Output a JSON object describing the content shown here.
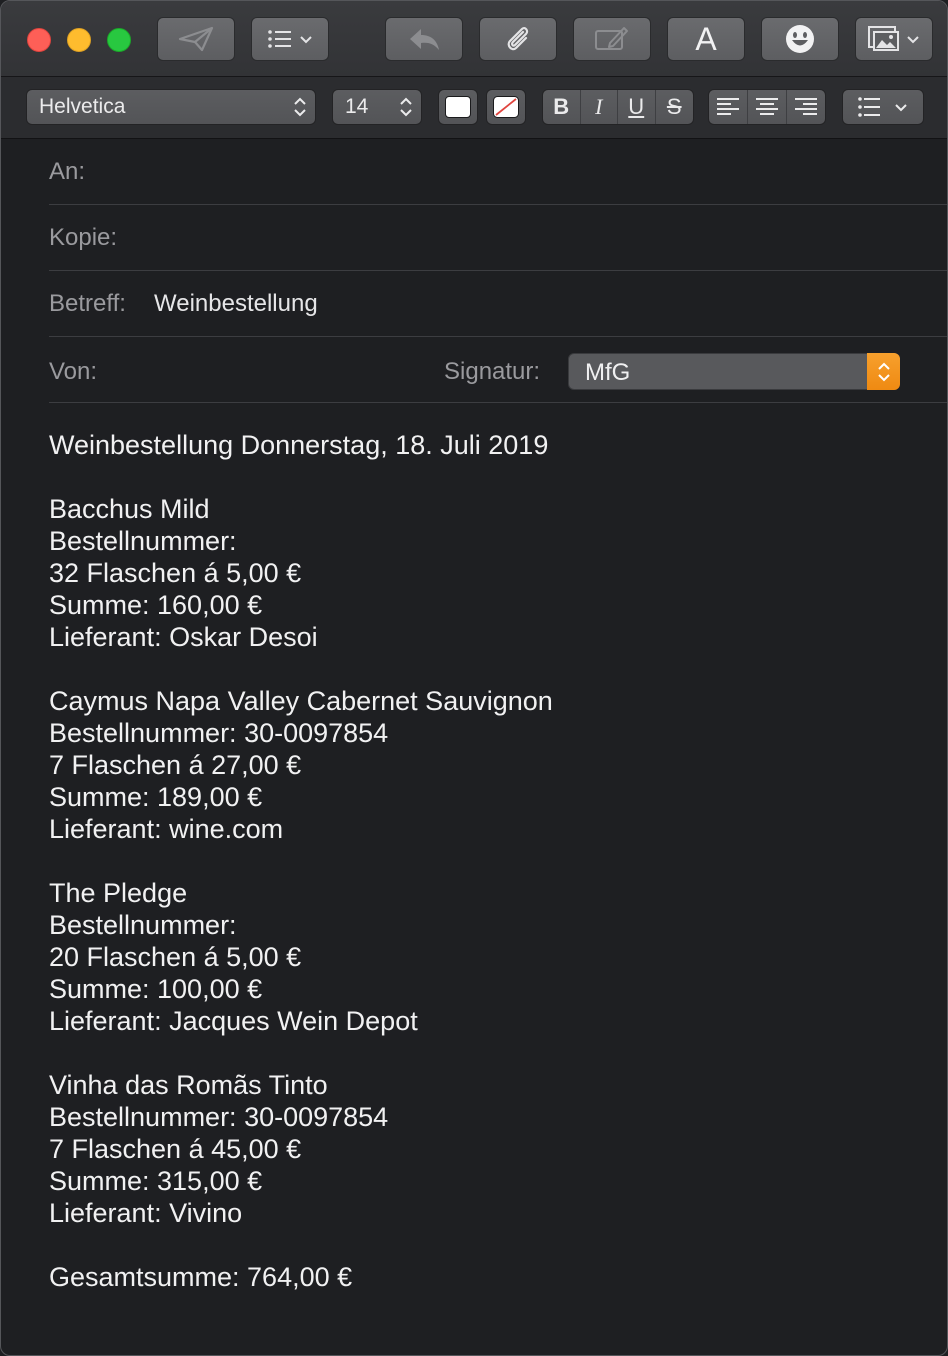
{
  "toolbar": {
    "buttons": [
      "send-icon",
      "list-menu-icon",
      "reply-icon",
      "paperclip-icon",
      "markup-icon",
      "font-icon",
      "emoji-icon",
      "photo-browser-icon"
    ],
    "font_button_label": "A"
  },
  "format_bar": {
    "font_family": "Helvetica",
    "font_size": "14",
    "bold_label": "B",
    "italic_label": "I",
    "underline_label": "U",
    "strike_label": "S"
  },
  "header": {
    "to_label": "An:",
    "to_value": "",
    "cc_label": "Kopie:",
    "cc_value": "",
    "subject_label": "Betreff:",
    "subject_value": "Weinbestellung",
    "from_label": "Von:",
    "signature_label": "Signatur:",
    "signature_value": "MfG"
  },
  "colors": {
    "accent": "#f29422",
    "background": "#1e1f22",
    "text": "#f1f1f2",
    "label": "#9a9a9e"
  },
  "message": {
    "heading": "Weinbestellung Donnerstag, 18. Juli 2019",
    "orders": [
      {
        "name": "Bacchus Mild",
        "order_number": "Bestellnummer:",
        "quantity": "32 Flaschen á 5,00 €",
        "sum": "Summe: 160,00 €",
        "supplier": "Lieferant: Oskar Desoi"
      },
      {
        "name": "Caymus Napa Valley Cabernet Sauvignon",
        "order_number": "Bestellnummer: 30-0097854",
        "quantity": "7 Flaschen á 27,00 €",
        "sum": "Summe: 189,00 €",
        "supplier": "Lieferant: wine.com"
      },
      {
        "name": "The Pledge",
        "order_number": "Bestellnummer:",
        "quantity": "20 Flaschen á 5,00 €",
        "sum": "Summe: 100,00 €",
        "supplier": "Lieferant: Jacques Wein Depot"
      },
      {
        "name": "Vinha das Romãs Tinto",
        "order_number": "Bestellnummer: 30-0097854",
        "quantity": "7 Flaschen á 45,00 €",
        "sum": "Summe: 315,00 €",
        "supplier": "Lieferant: Vivino"
      }
    ],
    "total": "Gesamtsumme: 764,00 €"
  }
}
